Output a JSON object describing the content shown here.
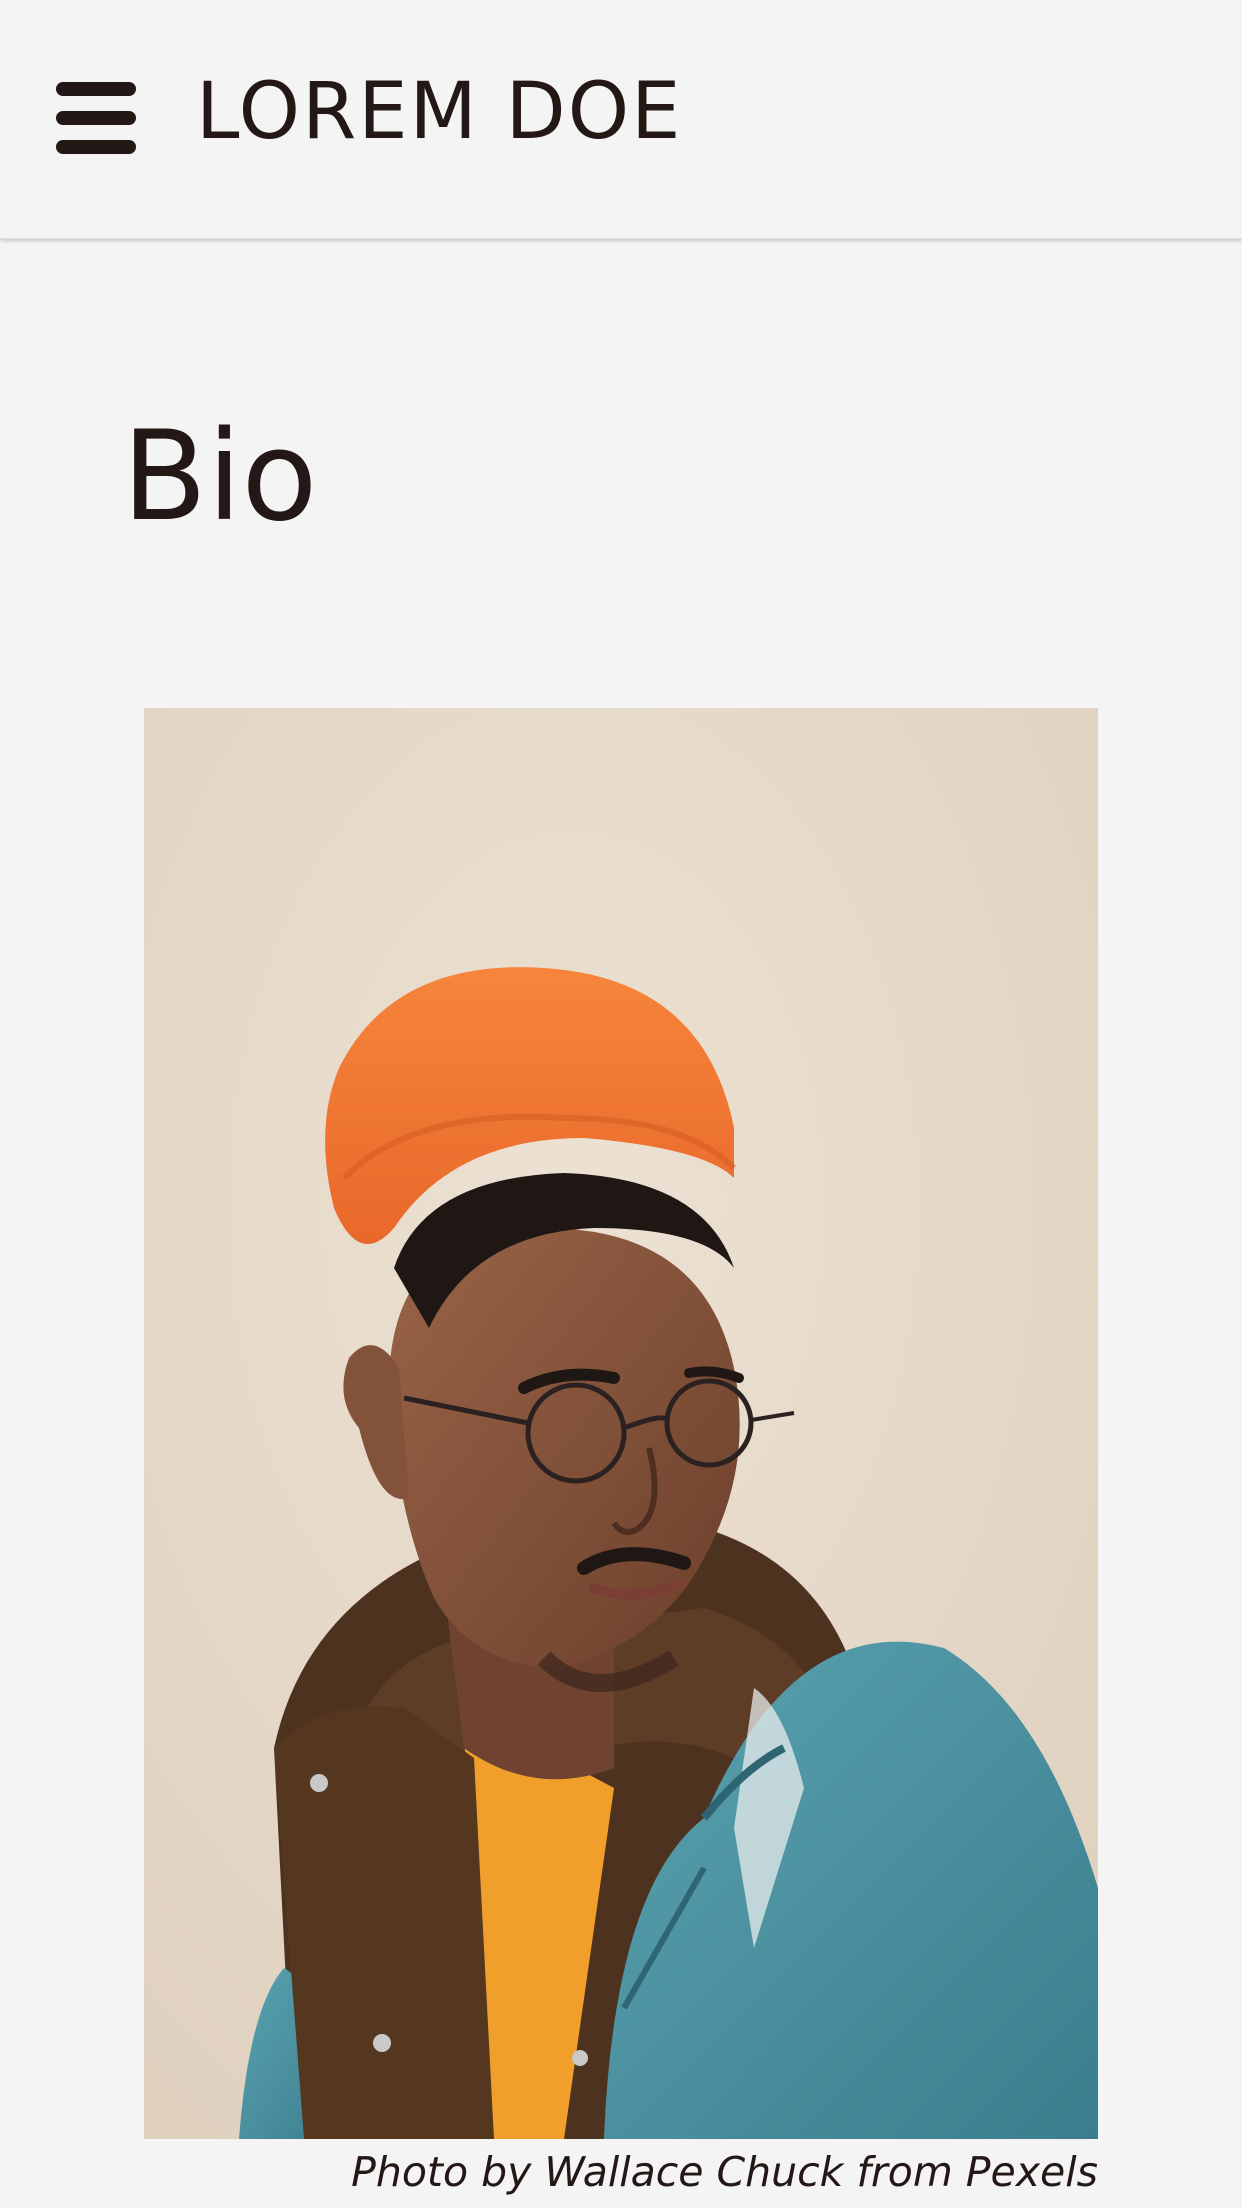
{
  "header": {
    "menu_icon": "hamburger-menu-icon",
    "site_title": "LOREM DOE"
  },
  "main": {
    "page_title": "Bio",
    "photo": {
      "alt": "Portrait of a man wearing an orange beanie, glasses, and a denim jacket",
      "credit": "Photo by Wallace Chuck from Pexels"
    }
  },
  "colors": {
    "background": "#f4f4f4",
    "text": "#231815",
    "beanie": "#f47a33",
    "denim": "#4f97a6",
    "hoodie": "#5a3a22",
    "shirt": "#f2a22e",
    "photo_backdrop": "#e6dacb"
  }
}
